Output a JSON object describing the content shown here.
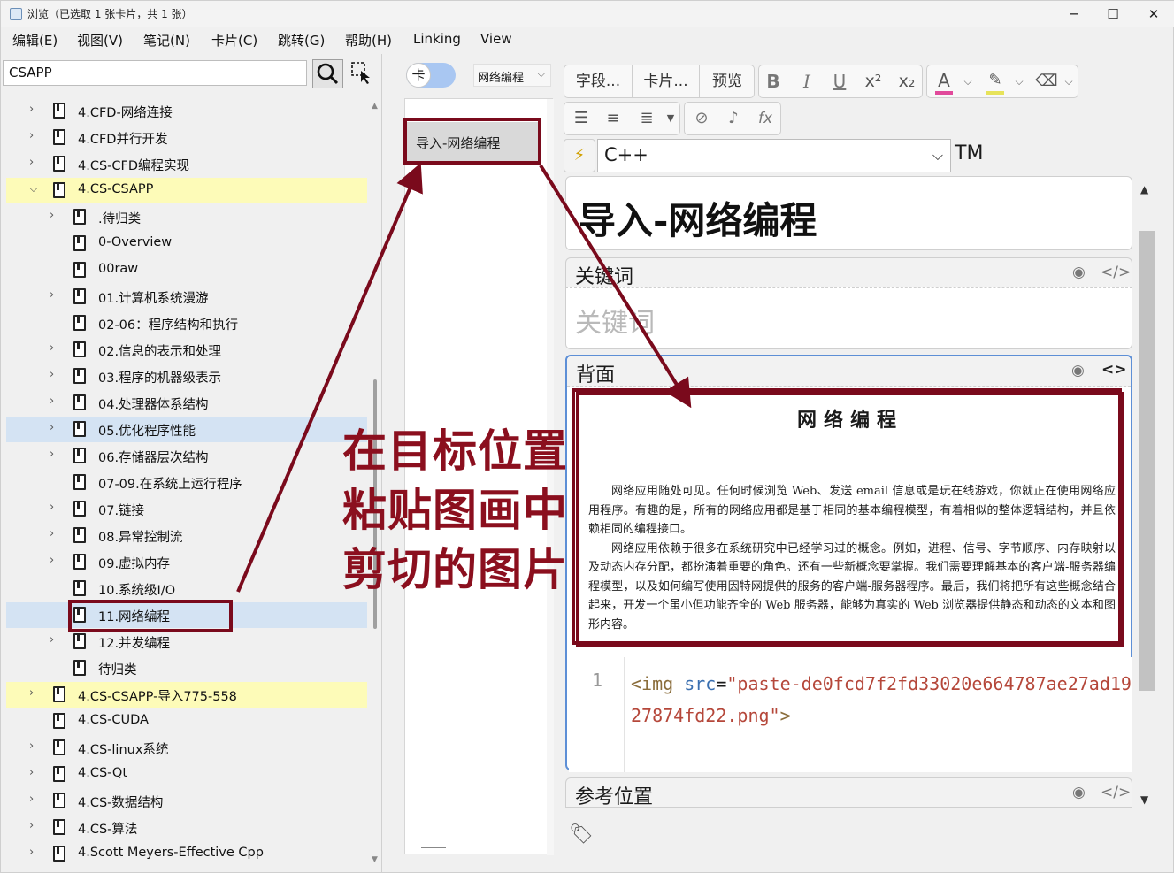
{
  "window": {
    "title": "浏览（已选取 1 张卡片，共 1 张）",
    "minimize": "─",
    "maximize": "☐",
    "close": "✕"
  },
  "menu": [
    "编辑(E)",
    "视图(V)",
    "笔记(N)",
    "卡片(C)",
    "跳转(G)",
    "帮助(H)",
    "Linking",
    "View"
  ],
  "search": {
    "value": "CSAPP"
  },
  "tree": [
    {
      "label": "4.CFD-网络连接",
      "level": 0,
      "expandable": true
    },
    {
      "label": "4.CFD并行开发",
      "level": 0,
      "expandable": true
    },
    {
      "label": "4.CS-CFD编程实现",
      "level": 0,
      "expandable": true
    },
    {
      "label": "4.CS-CSAPP",
      "level": 0,
      "expanded": true,
      "highlight": "yellow"
    },
    {
      "label": ".待归类",
      "level": 1,
      "expandable": true
    },
    {
      "label": "0-Overview",
      "level": 1
    },
    {
      "label": "00raw",
      "level": 1
    },
    {
      "label": "01.计算机系统漫游",
      "level": 1,
      "expandable": true
    },
    {
      "label": "02-06：程序结构和执行",
      "level": 1
    },
    {
      "label": "02.信息的表示和处理",
      "level": 1,
      "expandable": true
    },
    {
      "label": "03.程序的机器级表示",
      "level": 1,
      "expandable": true
    },
    {
      "label": "04.处理器体系结构",
      "level": 1,
      "expandable": true
    },
    {
      "label": "05.优化程序性能",
      "level": 1,
      "expandable": true,
      "highlight": "blue"
    },
    {
      "label": "06.存储器层次结构",
      "level": 1,
      "expandable": true
    },
    {
      "label": "07-09.在系统上运行程序",
      "level": 1
    },
    {
      "label": "07.链接",
      "level": 1,
      "expandable": true
    },
    {
      "label": "08.异常控制流",
      "level": 1,
      "expandable": true
    },
    {
      "label": "09.虚拟内存",
      "level": 1,
      "expandable": true
    },
    {
      "label": "10.系统级I/O",
      "level": 1
    },
    {
      "label": "11.网络编程",
      "level": 1,
      "highlight": "blue",
      "selected": true
    },
    {
      "label": "12.并发编程",
      "level": 1,
      "expandable": true
    },
    {
      "label": "待归类",
      "level": 1
    },
    {
      "label": "4.CS-CSAPP-导入775-558",
      "level": 0,
      "expandable": true,
      "highlight": "yellow"
    },
    {
      "label": "4.CS-CUDA",
      "level": 0
    },
    {
      "label": "4.CS-linux系统",
      "level": 0,
      "expandable": true
    },
    {
      "label": "4.CS-Qt",
      "level": 0,
      "expandable": true
    },
    {
      "label": "4.CS-数据结构",
      "level": 0,
      "expandable": true
    },
    {
      "label": "4.CS-算法",
      "level": 0,
      "expandable": true
    },
    {
      "label": "4.Scott Meyers-Effective Cpp",
      "level": 0,
      "expandable": true
    }
  ],
  "middle": {
    "toggle_label": "卡",
    "notetype": "网络编程",
    "cards": [
      "导入-网络编程"
    ]
  },
  "toolbar": {
    "fields_btn": "字段...",
    "cards_btn": "卡片...",
    "preview_btn": "预览",
    "bold": "B",
    "italic": "I",
    "underline": "U",
    "superscript": "x²",
    "subscript": "x₂",
    "font_color": "A",
    "formula": "fx"
  },
  "deck": {
    "value": "C++",
    "trailing": "TM"
  },
  "editor": {
    "title_text": "导入-网络编程",
    "keywords_label": "关键词",
    "keywords_placeholder": "关键词",
    "back_label": "背面",
    "reference_label": "参考位置",
    "pasted_image": {
      "heading": "网络编程",
      "paragraph1": "网络应用随处可见。任何时候浏览 Web、发送 email 信息或是玩在线游戏，你就正在使用网络应用程序。有趣的是，所有的网络应用都是基于相同的基本编程模型，有着相似的整体逻辑结构，并且依赖相同的编程接口。",
      "paragraph2": "网络应用依赖于很多在系统研究中已经学习过的概念。例如，进程、信号、字节顺序、内存映射以及动态内存分配，都扮演着重要的角色。还有一些新概念要掌握。我们需要理解基本的客户端-服务器编程模型，以及如何编写使用因特网提供的服务的客户端-服务器程序。最后，我们将把所有这些概念结合起来，开发一个虽小但功能齐全的 Web 服务器，能够为真实的 Web 浏览器提供静态和动态的文本和图形内容。"
    },
    "code": {
      "line_number": "1",
      "tag_open": "<img",
      "attr": "src",
      "eq": "=",
      "value": "\"paste-de0fcd7f2fd33020e664787ae27ad1927874fd22.png\"",
      "tag_close": ">"
    }
  },
  "annotation": {
    "lines": [
      "在目标位置",
      "粘贴图画中",
      "剪切的图片"
    ],
    "color": "#8b0f1e"
  },
  "colors": {
    "highlight_yellow": "#fdfbb8",
    "highlight_blue": "#d4e3f3",
    "annotation": "#7a0a1c"
  }
}
